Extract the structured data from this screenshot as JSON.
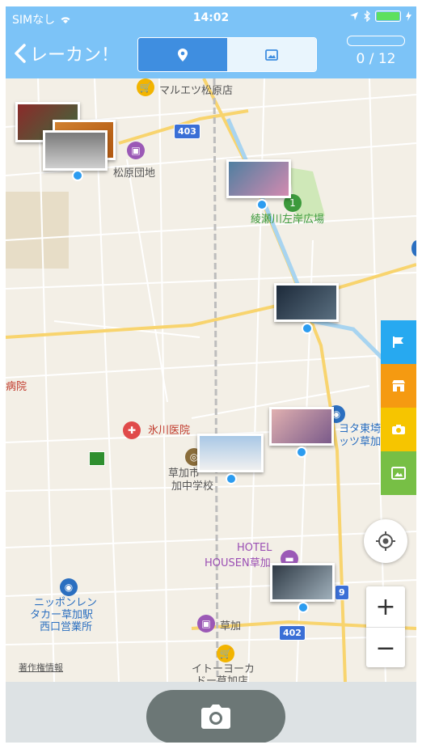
{
  "status": {
    "carrier": "SIMなし",
    "time": "14:02"
  },
  "header": {
    "back_label": "レーカン！",
    "progress": "0 / 12",
    "progress_value": 0,
    "progress_total": 12
  },
  "map": {
    "labels": {
      "matsubara_store": "マルエツ松原店",
      "matsubara_danchi": "松原団地",
      "ayasegawa": "綾瀬川左岸広場",
      "hospital": "病院",
      "hikawa": "氷川医院",
      "school1": "草加市",
      "school2": "加中学校",
      "toyota1": "ヨタ東埼",
      "toyota2": "ッツ草加",
      "hotel1": "HOTEL",
      "hotel2": "HOUSEN草加",
      "nippon1": "ニッポンレン",
      "nippon2": "タカー草加駅",
      "nippon3": "西口営業所",
      "soka": "草加",
      "ito1": "イトーヨーカ",
      "ito2": "ドー草加店",
      "road403": "403",
      "road402": "402",
      "road49": "9"
    },
    "copyright": "著作権情報"
  },
  "sidetabs": {
    "colors": [
      "#27a9f0",
      "#f59a11",
      "#f6c500",
      "#77bf45"
    ]
  },
  "zoom": {
    "plus": "+",
    "minus": "−"
  }
}
